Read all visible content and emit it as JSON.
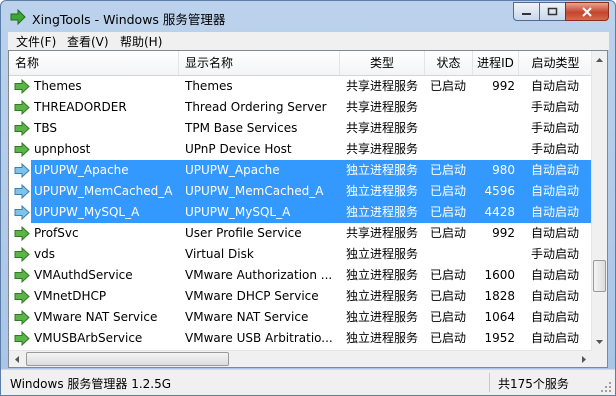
{
  "window": {
    "title": "XingTools - Windows 服务管理器"
  },
  "menu": [
    {
      "label": "文件(F)"
    },
    {
      "label": "查看(V)"
    },
    {
      "label": "帮助(H)"
    }
  ],
  "columns": [
    "名称",
    "显示名称",
    "类型",
    "状态",
    "进程ID",
    "启动类型"
  ],
  "rows": [
    {
      "name": "Themes",
      "display": "Themes",
      "type": "共享进程服务",
      "status": "已启动",
      "pid": "992",
      "startup": "自动启动",
      "selected": false
    },
    {
      "name": "THREADORDER",
      "display": "Thread Ordering Server",
      "type": "共享进程服务",
      "status": "",
      "pid": "",
      "startup": "手动启动",
      "selected": false
    },
    {
      "name": "TBS",
      "display": "TPM Base Services",
      "type": "共享进程服务",
      "status": "",
      "pid": "",
      "startup": "手动启动",
      "selected": false
    },
    {
      "name": "upnphost",
      "display": "UPnP Device Host",
      "type": "共享进程服务",
      "status": "",
      "pid": "",
      "startup": "手动启动",
      "selected": false
    },
    {
      "name": "UPUPW_Apache",
      "display": "UPUPW_Apache",
      "type": "独立进程服务",
      "status": "已启动",
      "pid": "980",
      "startup": "自动启动",
      "selected": true
    },
    {
      "name": "UPUPW_MemCached_A",
      "display": "UPUPW_MemCached_A",
      "type": "独立进程服务",
      "status": "已启动",
      "pid": "4596",
      "startup": "自动启动",
      "selected": true
    },
    {
      "name": "UPUPW_MySQL_A",
      "display": "UPUPW_MySQL_A",
      "type": "独立进程服务",
      "status": "已启动",
      "pid": "4428",
      "startup": "自动启动",
      "selected": true
    },
    {
      "name": "ProfSvc",
      "display": "User Profile Service",
      "type": "共享进程服务",
      "status": "已启动",
      "pid": "992",
      "startup": "自动启动",
      "selected": false
    },
    {
      "name": "vds",
      "display": "Virtual Disk",
      "type": "独立进程服务",
      "status": "",
      "pid": "",
      "startup": "手动启动",
      "selected": false
    },
    {
      "name": "VMAuthdService",
      "display": "VMware Authorization ...",
      "type": "独立进程服务",
      "status": "已启动",
      "pid": "1600",
      "startup": "自动启动",
      "selected": false
    },
    {
      "name": "VMnetDHCP",
      "display": "VMware DHCP Service",
      "type": "独立进程服务",
      "status": "已启动",
      "pid": "1828",
      "startup": "自动启动",
      "selected": false
    },
    {
      "name": "VMware NAT Service",
      "display": "VMware NAT Service",
      "type": "独立进程服务",
      "status": "已启动",
      "pid": "1064",
      "startup": "自动启动",
      "selected": false
    },
    {
      "name": "VMUSBArbService",
      "display": "VMware USB Arbitratio...",
      "type": "独立进程服务",
      "status": "已启动",
      "pid": "1952",
      "startup": "自动启动",
      "selected": false
    }
  ],
  "status": {
    "left": "Windows 服务管理器 1.2.5G",
    "right": "共175个服务"
  },
  "icons": {
    "app": "arrow-right-icon",
    "service": "service-arrow-icon"
  }
}
